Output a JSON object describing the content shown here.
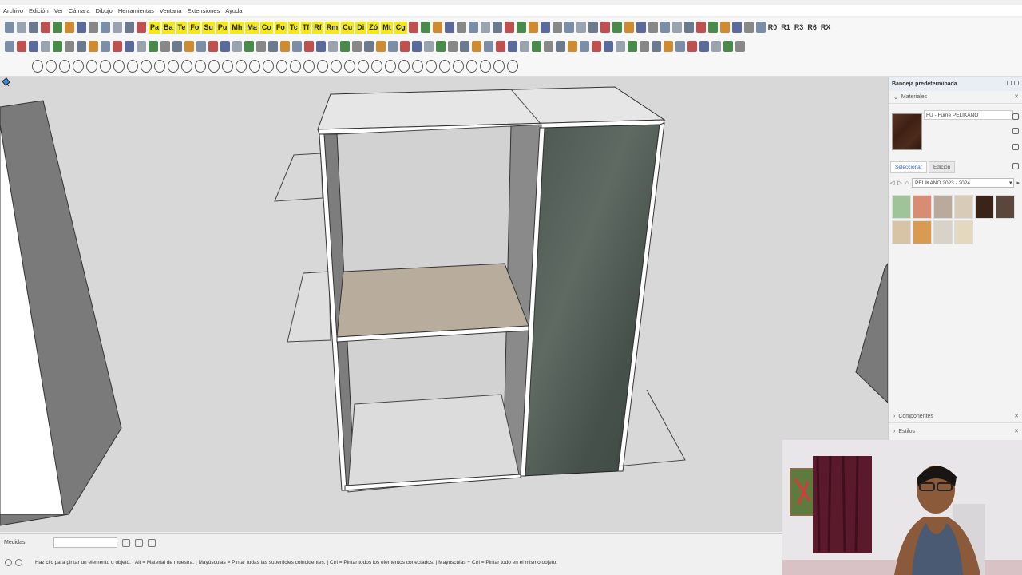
{
  "menu": [
    "Archivo",
    "Edición",
    "Ver",
    "Cámara",
    "Dibujo",
    "Herramientas",
    "Ventana",
    "Extensiones",
    "Ayuda"
  ],
  "toolbar": {
    "yellow_buttons": [
      "Pa",
      "Ba",
      "Te",
      "Fo",
      "Su",
      "Pu",
      "Mh",
      "Ma",
      "Co",
      "Fo",
      "Tc",
      "Tf",
      "Rf",
      "Rm",
      "Cu",
      "Di",
      "Zó",
      "Mt",
      "Cg"
    ],
    "text_buttons": [
      "R0",
      "R1",
      "R3",
      "R6",
      "RX"
    ]
  },
  "tray": {
    "title": "Bandeja predeterminada",
    "materials_header": "Materiales",
    "material_name": "FU - Fume PELIKANO",
    "tabs": [
      "Seleccionar",
      "Edición"
    ],
    "library": "PELIKANO 2023 - 2024",
    "swatch_colors": [
      "#9fc49a",
      "#d88c74",
      "#b9aa9c",
      "#d8cbb8",
      "#3a2418",
      "#5a463a",
      "#d7c4a6",
      "#d99b52",
      "#d9d2c8",
      "#e4d8be"
    ],
    "components_header": "Componentes",
    "styles_header": "Estilos"
  },
  "status": {
    "measure_label": "Medidas",
    "hint": "Haz clic para pintar un elemento u objeto. | Alt = Material de muestra. | Mayúsculas = Pintar todas las superficies coincidentes. | Ctrl = Pintar todos los elementos conectados. | Mayúsculas + Ctrl = Pintar todo en el mismo objeto."
  }
}
